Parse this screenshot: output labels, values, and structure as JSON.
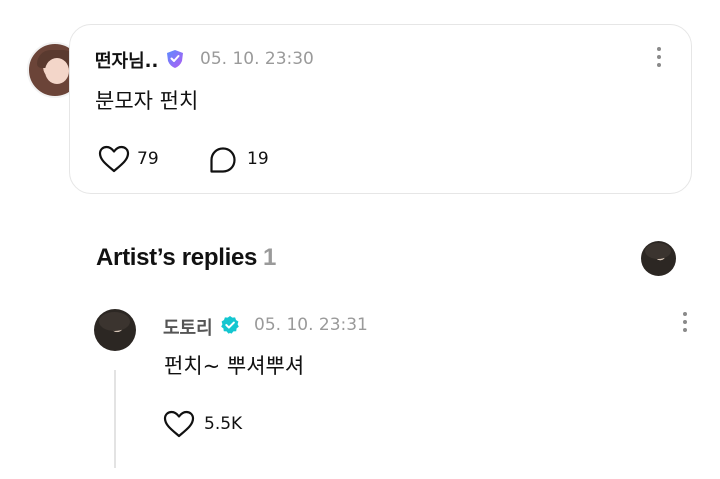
{
  "post": {
    "username": "떤자님..",
    "timestamp": "05. 10. 23:30",
    "text": "분모자 펀치",
    "likes": "79",
    "comments": "19"
  },
  "artist_replies": {
    "title": "Artist’s replies",
    "count": "1"
  },
  "reply": {
    "username": "도토리",
    "timestamp": "05. 10. 23:31",
    "text": "펀치~ 뿌셔뿌셔",
    "likes": "5.5K"
  },
  "icons": {
    "fan_badge": "shield-badge-icon",
    "artist_badge": "verified-check-icon",
    "like": "heart-icon",
    "comment": "speech-bubble-icon",
    "more": "more-vertical-icon"
  },
  "colors": {
    "fan_badge_start": "#5b8cff",
    "fan_badge_end": "#b15cf2",
    "artist_badge": "#14c6d0",
    "muted_text": "#9a9a9a"
  }
}
